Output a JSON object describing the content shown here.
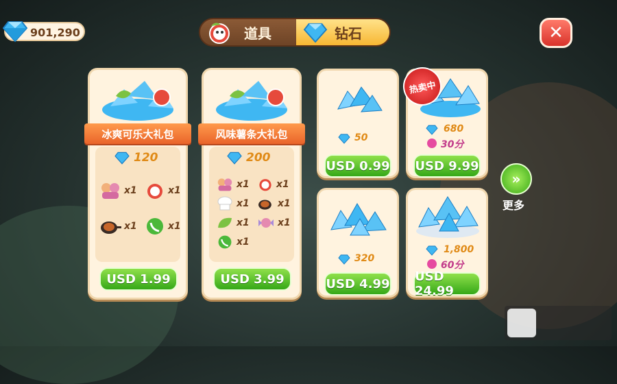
{
  "header": {
    "gem_balance": "901,290",
    "tabs": [
      {
        "label": "道具",
        "active": false
      },
      {
        "label": "钻石",
        "active": true
      }
    ],
    "close_symbol": "✕"
  },
  "bundles": [
    {
      "title": "冰爽可乐大礼包",
      "gems": "120",
      "items": [
        {
          "icon": "chef-figures-icon",
          "qty": "x1"
        },
        {
          "icon": "alarm-clock-icon",
          "qty": "x1"
        },
        {
          "icon": "frying-pan-icon",
          "qty": "x1"
        },
        {
          "icon": "green-phone-icon",
          "qty": "x1"
        }
      ],
      "price": "USD 1.99"
    },
    {
      "title": "风味薯条大礼包",
      "gems": "200",
      "items": [
        {
          "icon": "chef-figures-icon",
          "qty": "x1"
        },
        {
          "icon": "alarm-clock-icon",
          "qty": "x1"
        },
        {
          "icon": "chef-hat-icon",
          "qty": "x1"
        },
        {
          "icon": "frying-pan-icon",
          "qty": "x1"
        },
        {
          "icon": "leaf-icon",
          "qty": "x1"
        },
        {
          "icon": "candy-icon",
          "qty": "x1"
        },
        {
          "icon": "green-phone-icon",
          "qty": "x1"
        }
      ],
      "price": "USD 3.99"
    }
  ],
  "gem_packs": [
    {
      "gems": "50",
      "price": "USD 0.99"
    },
    {
      "gems": "680",
      "bonus": "30分",
      "price": "USD 9.99",
      "badge": "热卖中"
    },
    {
      "gems": "320",
      "price": "USD 4.99"
    },
    {
      "gems": "1,800",
      "bonus": "60分",
      "price": "USD 24.99"
    }
  ],
  "more": {
    "label": "更多",
    "symbol": "»"
  },
  "colors": {
    "accent_green": "#35a818",
    "gem_blue": "#3fb7f2",
    "ribbon_orange": "#e9642a"
  }
}
